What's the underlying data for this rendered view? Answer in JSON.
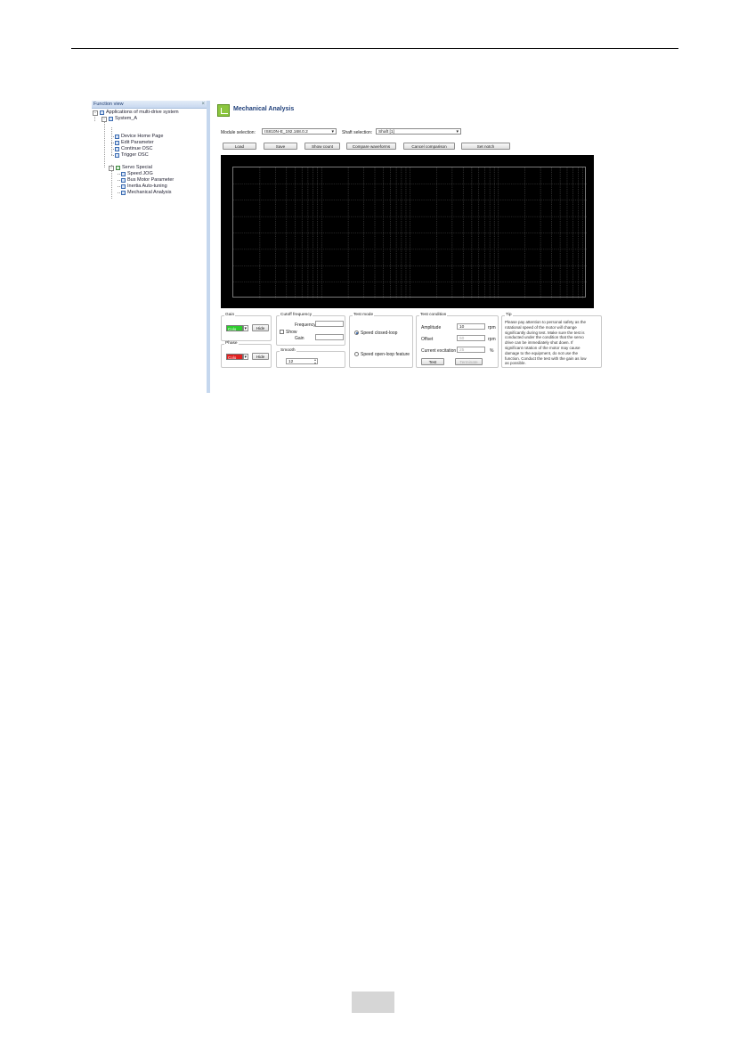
{
  "function_view": {
    "header": "Function view",
    "pin": "ₕ",
    "tree": {
      "root": "Applications of multi-drive system",
      "system": "System_A",
      "items": [
        "Device Home Page",
        "Edit Parameter",
        "Continue OSC",
        "Trigger OSC"
      ],
      "servo": "Servo Special",
      "servo_items": [
        "Speed JOG",
        "Bus Motor Parameter",
        "Inertia Auto-tuning",
        "Mechanical Analysis"
      ]
    }
  },
  "main": {
    "title": "Mechanical Analysis",
    "module_label": "Module selection:",
    "module_value": "IS810N-E_192.168.0.2",
    "shaft_label": "Shaft selection:",
    "shaft_value": "Shaft [1]",
    "buttons": [
      "Load",
      "Save",
      "Show count",
      "Compare waveforms",
      "Cancel comparison",
      "Set notch"
    ]
  },
  "gain": {
    "title": "Gain",
    "color_text": "Colo",
    "hide": "Hide",
    "color": "#2ecc2e"
  },
  "phase": {
    "title": "Phase",
    "color_text": "Colo",
    "hide": "Hide",
    "color": "#e02020"
  },
  "cutoff": {
    "title": "Cutoff frequency",
    "frequency": "Frequency",
    "show": "Show",
    "gain": "Gain"
  },
  "smooth": {
    "title": "Smooth",
    "value": "12"
  },
  "test_mode": {
    "title": "Test mode",
    "options": [
      "Speed closed-loop",
      "Speed open-loop feature"
    ],
    "selected": 0
  },
  "test_condition": {
    "title": "Test condition",
    "amplitude_label": "Amplitude",
    "amplitude_value": "10",
    "amplitude_unit": "rpm",
    "offset_label": "Offset",
    "offset_value": "50",
    "offset_unit": "rpm",
    "current_label": "Current excitation",
    "current_value": "25",
    "current_unit": "%",
    "test_btn": "Test",
    "terminate_btn": "Terminate"
  },
  "tip": {
    "title": "Tip",
    "lines": [
      "Please pay attention to personal safety as the",
      "rotational speed of the motor will change",
      "significantly during test. Make sure the test is",
      "conducted under the condition that the servo",
      "drive can be immediately shut down. If",
      "significant rotation of the motor may cause",
      "damage to the equipment, do not use the",
      "function. Conduct the test with the gain as low",
      "as possible."
    ]
  },
  "colors": {
    "scope_bg": "#000000",
    "title": "#1f3f7a",
    "panel_border": "#c5d7ee"
  }
}
